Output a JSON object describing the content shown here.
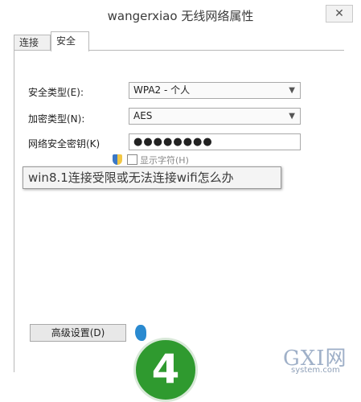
{
  "window": {
    "title": "wangerxiao 无线网络属性",
    "close_glyph": "✕"
  },
  "tabs": [
    {
      "label": "连接",
      "active": false
    },
    {
      "label": "安全",
      "active": true
    }
  ],
  "security": {
    "type_label": "安全类型(E):",
    "type_value": "WPA2 - 个人",
    "encryption_label": "加密类型(N):",
    "encryption_value": "AES",
    "key_label": "网络安全密钥(K)",
    "key_value": "●●●●●●●●",
    "show_chars_label": "显示字符(H)"
  },
  "advanced_button": {
    "label": "高级设置(D)"
  },
  "overlay": {
    "banner_text": "win8.1连接受限或无法连接wifi怎么办",
    "step_number": "4"
  },
  "watermark": {
    "main": "GXI网",
    "sub": "system.com"
  },
  "colors": {
    "badge_green": "#2f9a2f",
    "watermark": "#9fb0c8"
  },
  "icons": {
    "dropdown": "chevron-down-icon",
    "uac_shield": "shield-icon"
  }
}
